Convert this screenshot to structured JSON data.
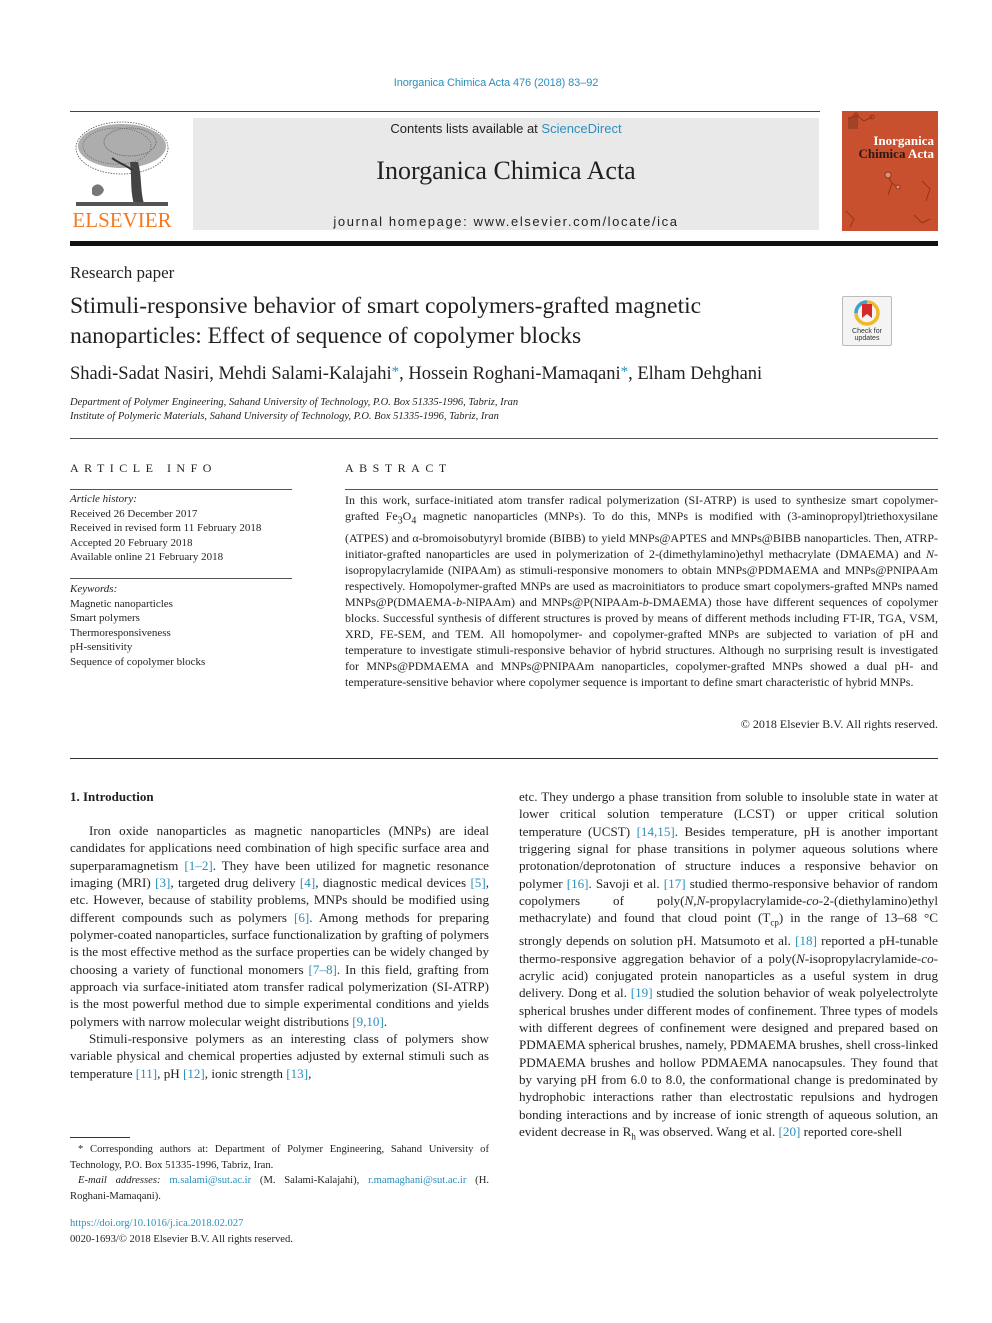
{
  "header": {
    "citation": "Inorganica Chimica Acta 476 (2018) 83–92",
    "contents_prefix": "Contents lists available at ",
    "contents_link": "ScienceDirect",
    "journal_title": "Inorganica Chimica Acta",
    "homepage_prefix": "journal homepage: ",
    "homepage_url": "www.elsevier.com/locate/ica",
    "publisher_logo_text": "ELSEVIER",
    "cover_title_line1": "Inorganica",
    "cover_title_line2a": "Chimica",
    "cover_title_line2b": "Acta",
    "colors": {
      "link": "#2a8fbd",
      "elsevier_orange": "#f47920",
      "cover_red": "#c8502e",
      "masthead_gray": "#e9e9e9"
    }
  },
  "article": {
    "type": "Research paper",
    "title": "Stimuli-responsive behavior of smart copolymers-grafted magnetic nanoparticles: Effect of sequence of copolymer blocks",
    "crossmark_label_1": "Check for",
    "crossmark_label_2": "updates",
    "authors": [
      {
        "name": "Shadi-Sadat Nasiri",
        "corresponding": false
      },
      {
        "name": "Mehdi Salami-Kalajahi",
        "corresponding": true
      },
      {
        "name": "Hossein Roghani-Mamaqani",
        "corresponding": true
      },
      {
        "name": "Elham Dehghani",
        "corresponding": false
      }
    ],
    "affiliations": [
      "Department of Polymer Engineering, Sahand University of Technology, P.O. Box 51335-1996, Tabriz, Iran",
      "Institute of Polymeric Materials, Sahand University of Technology, P.O. Box 51335-1996, Tabriz, Iran"
    ]
  },
  "article_info": {
    "heading": "ARTICLE INFO",
    "history_label": "Article history:",
    "history": [
      "Received 26 December 2017",
      "Received in revised form 11 February 2018",
      "Accepted 20 February 2018",
      "Available online 21 February 2018"
    ],
    "keywords_label": "Keywords:",
    "keywords": [
      "Magnetic nanoparticles",
      "Smart polymers",
      "Thermoresponsiveness",
      "pH-sensitivity",
      "Sequence of copolymer blocks"
    ]
  },
  "abstract": {
    "heading": "ABSTRACT",
    "p1": "In this work, surface-initiated atom transfer radical polymerization (SI-ATRP) is used to synthesize smart copolymer-grafted Fe",
    "sub1": "3",
    "p2": "O",
    "sub2": "4",
    "p3": " magnetic nanoparticles (MNPs). To do this, MNPs is modified with (3-aminopropyl)triethoxysilane (ATPES) and α-bromoisobutyryl bromide (BIBB) to yield MNPs@APTES and MNPs@BIBB nanoparticles. Then, ATRP-initiator-grafted nanoparticles are used in polymerization of 2-(dimethylamino)ethyl methacrylate (DMAEMA) and ",
    "italic_n": "N",
    "p4": "-isopropylacrylamide (NIPAAm) as stimuli-responsive monomers to obtain MNPs@PDMAEMA and MNPs@PNIPAAm respectively. Homopolymer-grafted MNPs are used as macroinitiators to produce smart copolymers-grafted MNPs named MNPs@P(DMAEMA-",
    "italic_b1": "b",
    "p5": "-NIPAAm) and MNPs@P(NIPAAm-",
    "italic_b2": "b",
    "p6": "-DMAEMA) those have different sequences of copolymer blocks. Successful synthesis of different structures is proved by means of different methods including FT-IR, TGA, VSM, XRD, FE-SEM, and TEM. All homopolymer- and copolymer-grafted MNPs are subjected to variation of pH and temperature to investigate stimuli-responsive behavior of hybrid structures. Although no surprising result is investigated for MNPs@PDMAEMA and MNPs@PNIPAAm nanoparticles, copolymer-grafted MNPs showed a dual pH- and temperature-sensitive behavior where copolymer sequence is important to define smart characteristic of hybrid MNPs.",
    "copyright": "© 2018 Elsevier B.V. All rights reserved."
  },
  "introduction": {
    "heading": "1. Introduction",
    "left": {
      "a1": "Iron oxide nanoparticles as magnetic nanoparticles (MNPs) are ideal candidates for applications need combination of high specific surface area and superparamagnetism ",
      "r1": "[1–2]",
      "a2": ". They have been utilized for magnetic resonance imaging (MRI) ",
      "r2": "[3]",
      "a3": ", targeted drug delivery ",
      "r3": "[4]",
      "a4": ", diagnostic medical devices ",
      "r4": "[5]",
      "a5": ", etc. However, because of stability problems, MNPs should be modified using different compounds such as polymers ",
      "r5": "[6]",
      "a6": ". Among methods for preparing polymer-coated nanoparticles, surface functionalization by grafting of polymers is the most effective method as the surface properties can be widely changed by choosing a variety of functional monomers ",
      "r6": "[7–8]",
      "a7": ". In this field, grafting from approach via surface-initiated atom transfer radical polymerization (SI-ATRP) is the most powerful method due to simple experimental conditions and yields polymers with narrow molecular weight distributions ",
      "r7": "[9,10]",
      "a8": ".",
      "b1": "Stimuli-responsive polymers as an interesting class of polymers show variable physical and chemical properties adjusted by external stimuli such as temperature ",
      "s1": "[11]",
      "b2": ", pH ",
      "s2": "[12]",
      "b3": ", ionic strength ",
      "s3": "[13]",
      "b4": ","
    },
    "right": {
      "c1": "etc. They undergo a phase transition from soluble to insoluble state in water at lower critical solution temperature (LCST) or upper critical solution temperature (UCST) ",
      "t1": "[14,15]",
      "c2": ". Besides temperature, pH is another important triggering signal for phase transitions in polymer aqueous solutions where protonation/deprotonation of structure induces a responsive behavior on polymer ",
      "t2": "[16]",
      "c3": ". Savoji et al. ",
      "t3": "[17]",
      "c4": " studied thermo-responsive behavior of random copolymers of poly(",
      "i1": "N,N",
      "c5": "-propylacrylamide-",
      "i2": "co",
      "c6": "-2-(diethylamino)ethyl methacrylate) and found that cloud point (T",
      "sub_cp": "cp",
      "c7": ") in the range of 13–68 °C strongly depends on solution pH. Matsumoto et al. ",
      "t4": "[18]",
      "c8": " reported a pH-tunable thermo-responsive aggregation behavior of a poly(",
      "i3": "N",
      "c9": "-isopropylacrylamide-",
      "i4": "co",
      "c10": "-acrylic acid) conjugated protein nanoparticles as a useful system in drug delivery. Dong et al. ",
      "t5": "[19]",
      "c11": " studied the solution behavior of weak polyelectrolyte spherical brushes under different modes of confinement. Three types of models with different degrees of confinement were designed and prepared based on PDMAEMA spherical brushes, namely, PDMAEMA brushes, shell cross-linked PDMAEMA brushes and hollow PDMAEMA nanocapsules. They found that by varying pH from 6.0 to 8.0, the conformational change is predominated by hydrophobic interactions rather than electrostatic repulsions and hydrogen bonding interactions and by increase of ionic strength of aqueous solution, an evident decrease in R",
      "sub_h": "h",
      "c12": " was observed. Wang et al. ",
      "t6": "[20]",
      "c13": " reported core-shell"
    }
  },
  "footnotes": {
    "corresponding": "* Corresponding authors at: Department of Polymer Engineering, Sahand University of Technology, P.O. Box 51335-1996, Tabriz, Iran.",
    "email_label": "E-mail addresses:",
    "email1": "m.salami@sut.ac.ir",
    "email1_owner": " (M. Salami-Kalajahi), ",
    "email2": "r.mamaghani@sut.ac.ir",
    "email2_owner": " (H. Roghani-Mamaqani).",
    "doi": "https://doi.org/10.1016/j.ica.2018.02.027",
    "issn": "0020-1693/© 2018 Elsevier B.V. All rights reserved."
  }
}
